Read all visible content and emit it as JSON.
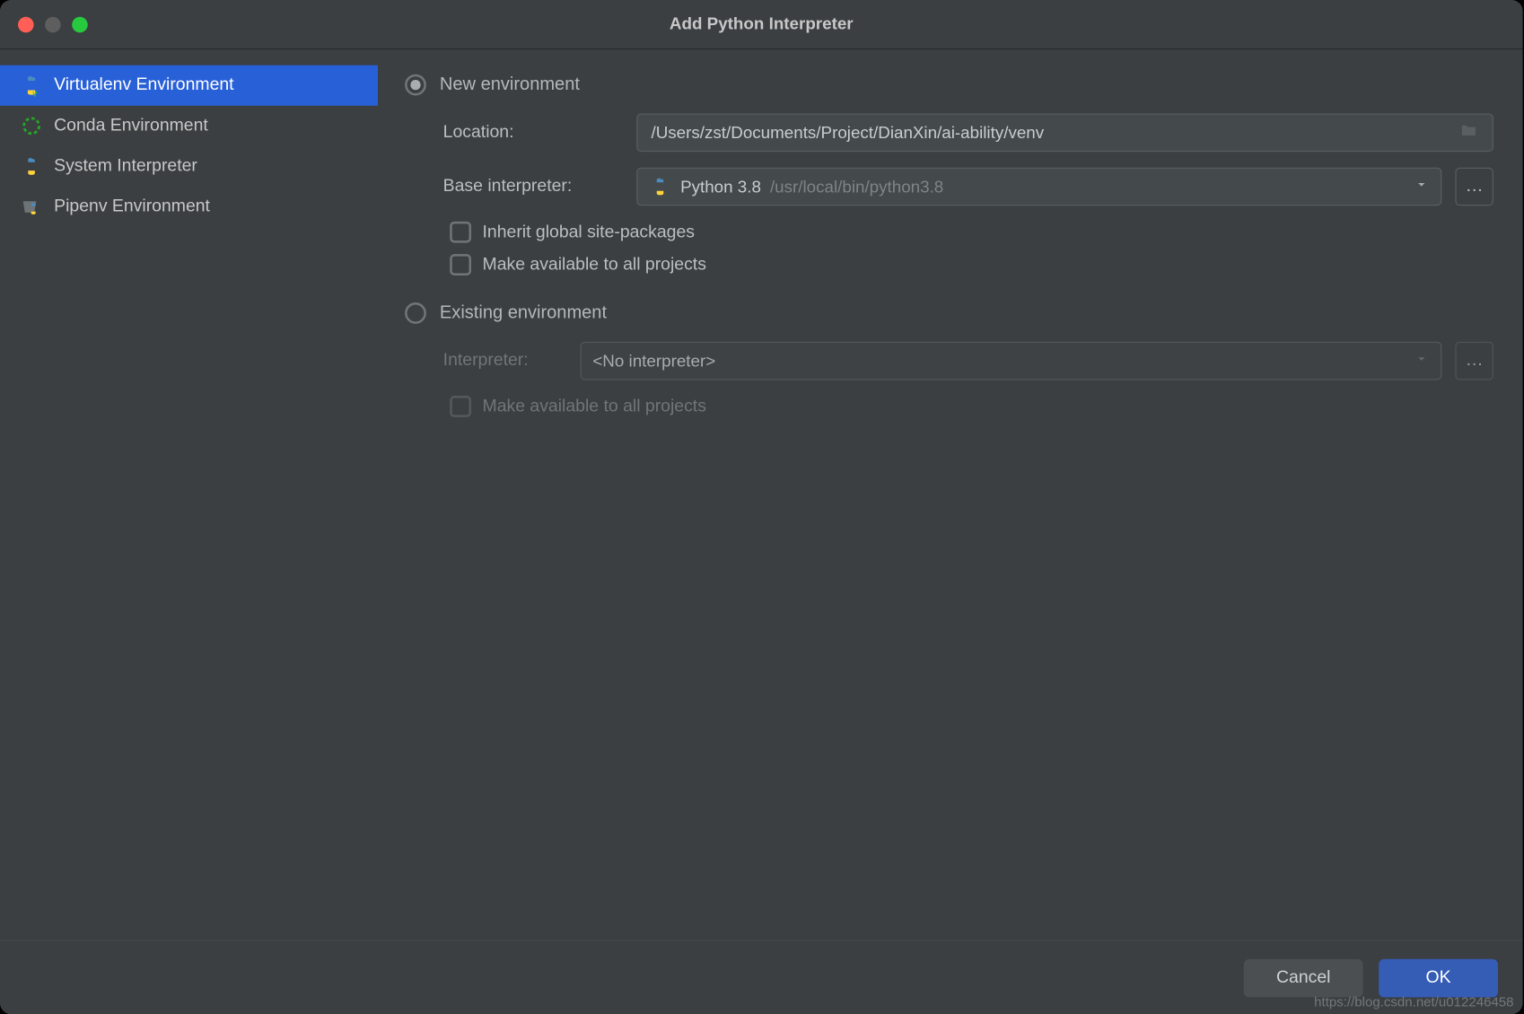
{
  "window": {
    "title": "Add Python Interpreter"
  },
  "sidebar": {
    "items": [
      {
        "label": "Virtualenv Environment"
      },
      {
        "label": "Conda Environment"
      },
      {
        "label": "System Interpreter"
      },
      {
        "label": "Pipenv Environment"
      }
    ]
  },
  "main": {
    "new_env": {
      "radio_label": "New environment",
      "location_label": "Location:",
      "location_value": "/Users/zst/Documents/Project/DianXin/ai-ability/venv",
      "base_interpreter_label": "Base interpreter:",
      "base_interpreter_name": "Python 3.8",
      "base_interpreter_path": "/usr/local/bin/python3.8",
      "inherit_label": "Inherit global site-packages",
      "make_available_label": "Make available to all projects"
    },
    "existing_env": {
      "radio_label": "Existing environment",
      "interpreter_label": "Interpreter:",
      "interpreter_value": "<No interpreter>",
      "make_available_label": "Make available to all projects"
    }
  },
  "footer": {
    "cancel": "Cancel",
    "ok": "OK"
  },
  "watermark": "https://blog.csdn.net/u012246458"
}
